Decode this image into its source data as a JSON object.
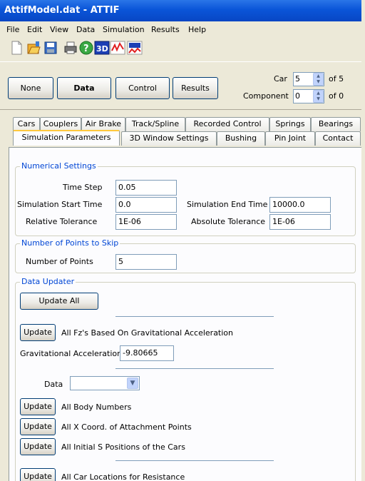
{
  "window": {
    "title": "AttifModel.dat - ATTIF"
  },
  "menu": [
    "File",
    "Edit",
    "View",
    "Data",
    "Simulation",
    "Results",
    "Help"
  ],
  "toolbar_icons": [
    "new-file-icon",
    "open-folder-icon",
    "save-icon",
    "print-icon",
    "help-icon",
    "3d-view-icon",
    "plot-icon",
    "3d-plot-icon"
  ],
  "toolbar_labels": {
    "view3d": "3D"
  },
  "mode_buttons": {
    "none": "None",
    "data": "Data",
    "control": "Control",
    "results": "Results"
  },
  "car": {
    "label": "Car",
    "value": "5",
    "of": "of 5"
  },
  "component": {
    "label": "Component",
    "value": "0",
    "of": "of 0"
  },
  "tabs_row1": [
    "Cars",
    "Couplers",
    "Air Brake",
    "Track/Spline",
    "Recorded Control",
    "Springs",
    "Bearings"
  ],
  "tabs_row2": [
    "Simulation Parameters",
    "3D Window Settings",
    "Bushing",
    "Pin Joint",
    "Contact"
  ],
  "numerical": {
    "title": "Numerical Settings",
    "time_step_label": "Time Step",
    "time_step": "0.05",
    "start_label": "Simulation Start Time",
    "start": "0.0",
    "end_label": "Simulation End Time",
    "end": "10000.0",
    "rel_label": "Relative Tolerance",
    "rel": "1E-06",
    "abs_label": "Absolute Tolerance",
    "abs": "1E-06"
  },
  "skip": {
    "title": "Number of Points to Skip",
    "label": "Number of Points",
    "value": "5"
  },
  "updater": {
    "title": "Data Updater",
    "update_all": "Update All",
    "update": "Update",
    "fz_text": "All Fz's Based On Gravitational Acceleration",
    "grav_label": "Gravitational Acceleration",
    "grav_value": "-9.80665",
    "data_label": "Data",
    "data_value": "",
    "body_numbers": "All Body Numbers",
    "x_coord": "All X Coord. of Attachment Points",
    "initial_s": "All Initial S Positions of the Cars",
    "car_locations": "All Car Locations for Resistance"
  }
}
